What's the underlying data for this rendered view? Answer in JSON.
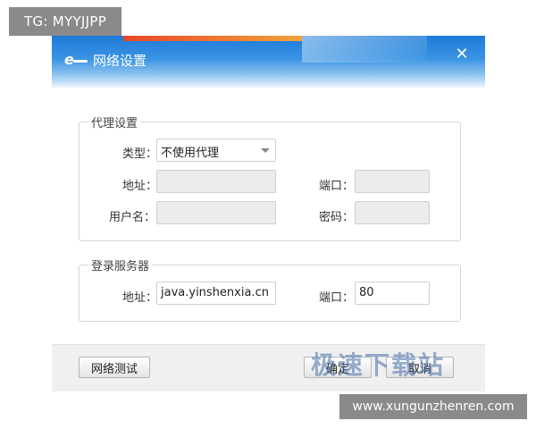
{
  "overlay": {
    "tg_tag": "TG: MYYJJPP",
    "site_url": "www.xungunzhenren.com",
    "watermark": "极速下载站"
  },
  "dialog": {
    "title": "网络设置",
    "close_icon": "close-icon",
    "app_icon": "ie-logo-icon"
  },
  "proxy": {
    "group_title": "代理设置",
    "type_label": "类型：",
    "type_value": "不使用代理",
    "address_label": "地址：",
    "address_value": "",
    "port_label": "端口：",
    "port_value": "",
    "username_label": "用户名：",
    "username_value": "",
    "password_label": "密码：",
    "password_value": ""
  },
  "login_server": {
    "group_title": "登录服务器",
    "address_label": "地址：",
    "address_value": "java.yinshenxia.cn",
    "port_label": "端口：",
    "port_value": "80"
  },
  "footer": {
    "test_button": "网络测试",
    "ok_button": "确定",
    "cancel_button": "取消"
  }
}
